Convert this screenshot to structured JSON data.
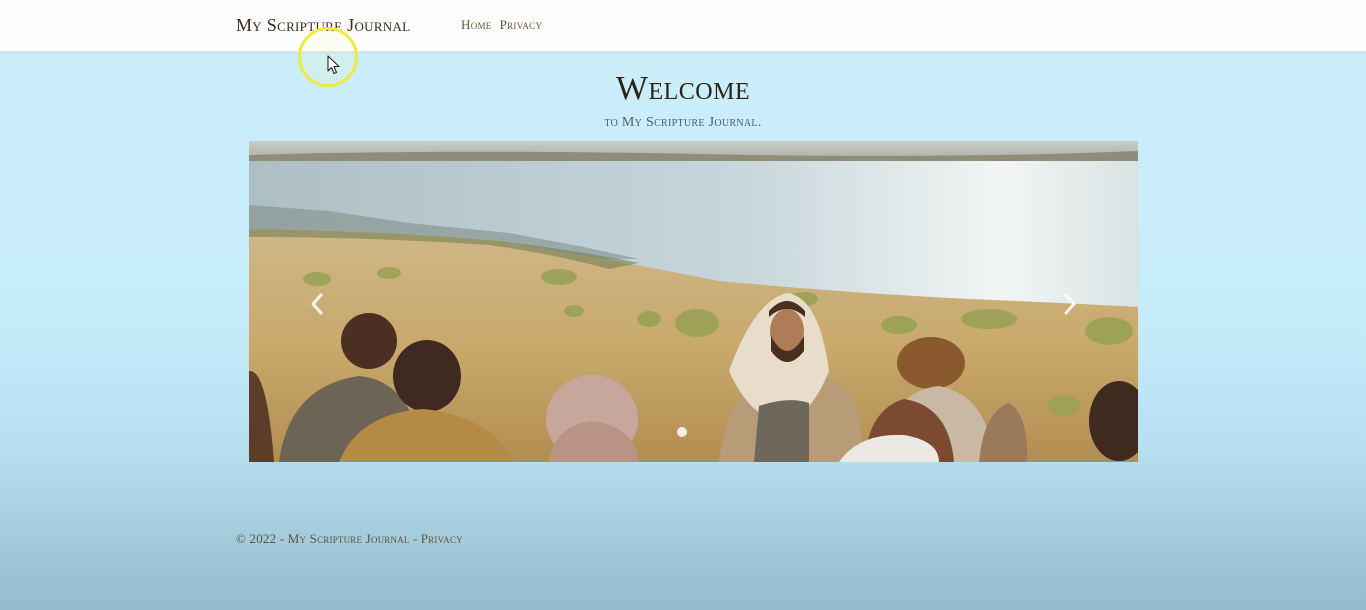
{
  "navbar": {
    "brand": "My Scripture Journal",
    "links": [
      "Home",
      "Privacy"
    ]
  },
  "hero": {
    "title": "Welcome",
    "subtitle": "to My Scripture Journal."
  },
  "carousel": {
    "prev_icon": "chevron-left-icon",
    "next_icon": "chevron-right-icon",
    "slide_count": 1,
    "active_slide": 1
  },
  "footer": {
    "copyright": "© 2022 - My Scripture Journal -",
    "privacy_link": "Privacy"
  },
  "colors": {
    "nav_bg": "#fdfdfd",
    "page_bg_top": "#c6ecfb",
    "page_bg_bottom": "#93bccc",
    "text_brown": "#3b2a1b",
    "cursor_highlight": "#f0ea3a"
  }
}
